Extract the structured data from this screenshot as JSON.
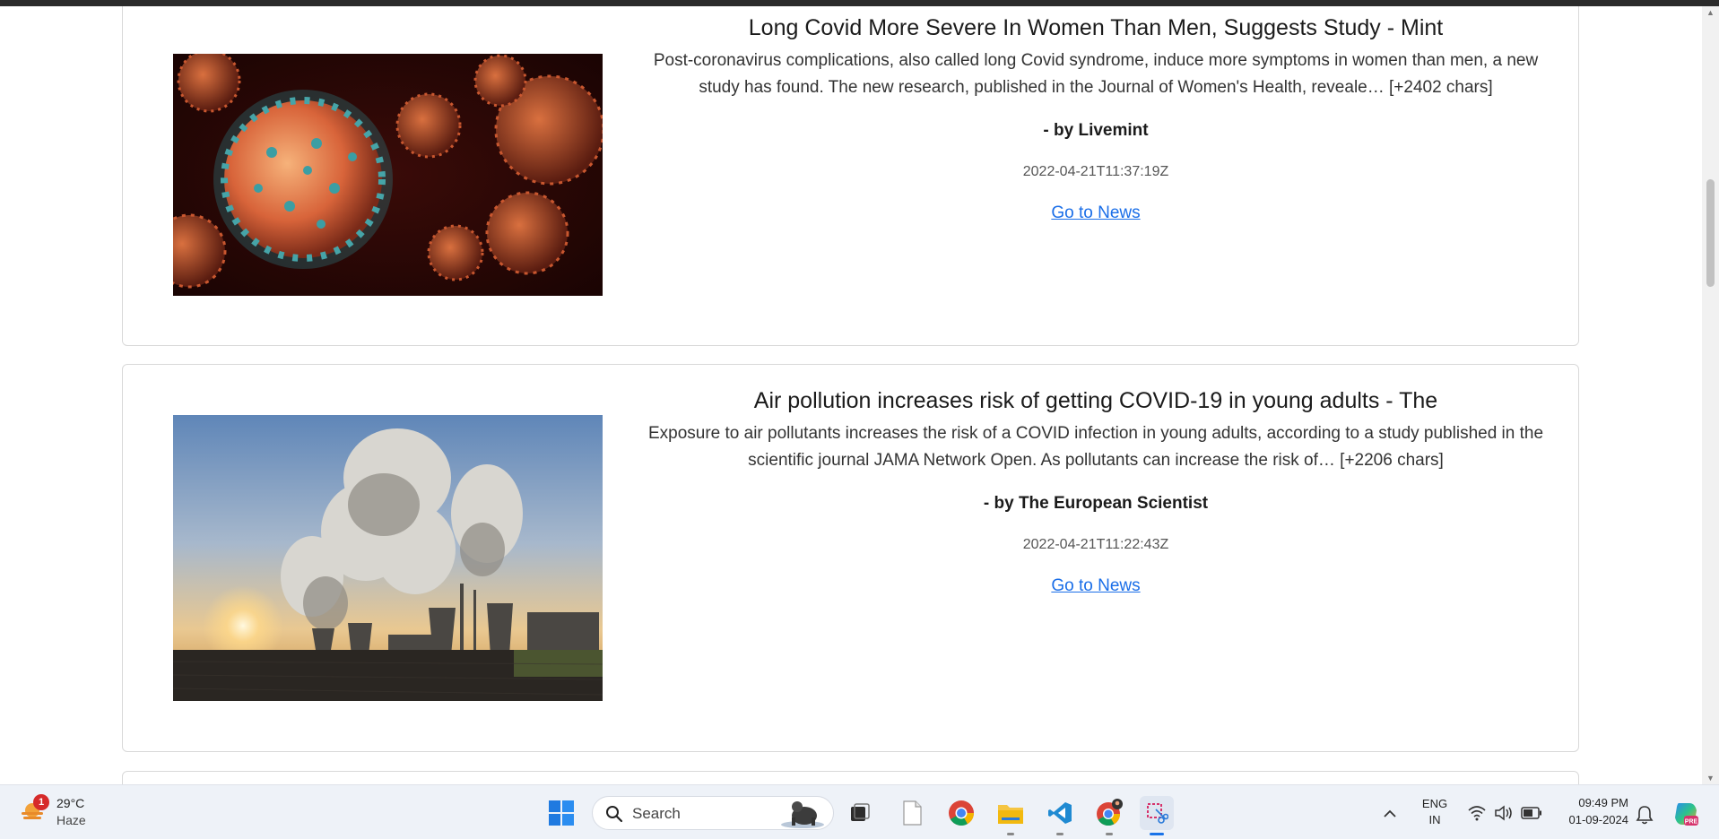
{
  "articles": [
    {
      "title": "Long Covid More Severe In Women Than Men, Suggests Study - Mint",
      "description": "Post-coronavirus complications, also called long Covid syndrome, induce more symptoms in women than men, a new study has found.  The new research, published in the Journal of Women's Health, reveale… [+2402 chars]",
      "author": "- by Livemint",
      "date": "2022-04-21T11:37:19Z",
      "link_label": "Go to News"
    },
    {
      "title": "Air pollution increases risk of getting COVID-19 in young adults - The",
      "description": "Exposure to air pollutants increases the risk of a COVID infection in young adults, according to a study published in the scientific journal JAMA Network Open. As pollutants can increase the risk of… [+2206 chars]",
      "author": "- by The European Scientist",
      "date": "2022-04-21T11:22:43Z",
      "link_label": "Go to News"
    }
  ],
  "taskbar": {
    "weather_badge": "1",
    "weather_temp": "29°C",
    "weather_condition": "Haze",
    "search_placeholder": "Search",
    "language": "ENG",
    "region": "IN",
    "time": "09:49 PM",
    "date": "01-09-2024"
  },
  "colors": {
    "link": "#1a6ee8",
    "card_border": "#d9d9d9",
    "taskbar_bg": "#eef2f8",
    "top_bar": "#2b2b2b"
  },
  "icons": {
    "taskbar": [
      "windows-start-icon",
      "search-icon",
      "task-view-icon",
      "notepad-icon",
      "chrome-icon",
      "file-explorer-icon",
      "vscode-icon",
      "chrome-profile-icon",
      "snipping-tool-icon"
    ],
    "tray": [
      "chevron-up-icon",
      "wifi-icon",
      "speaker-icon",
      "battery-icon",
      "bell-icon",
      "copilot-icon"
    ]
  }
}
